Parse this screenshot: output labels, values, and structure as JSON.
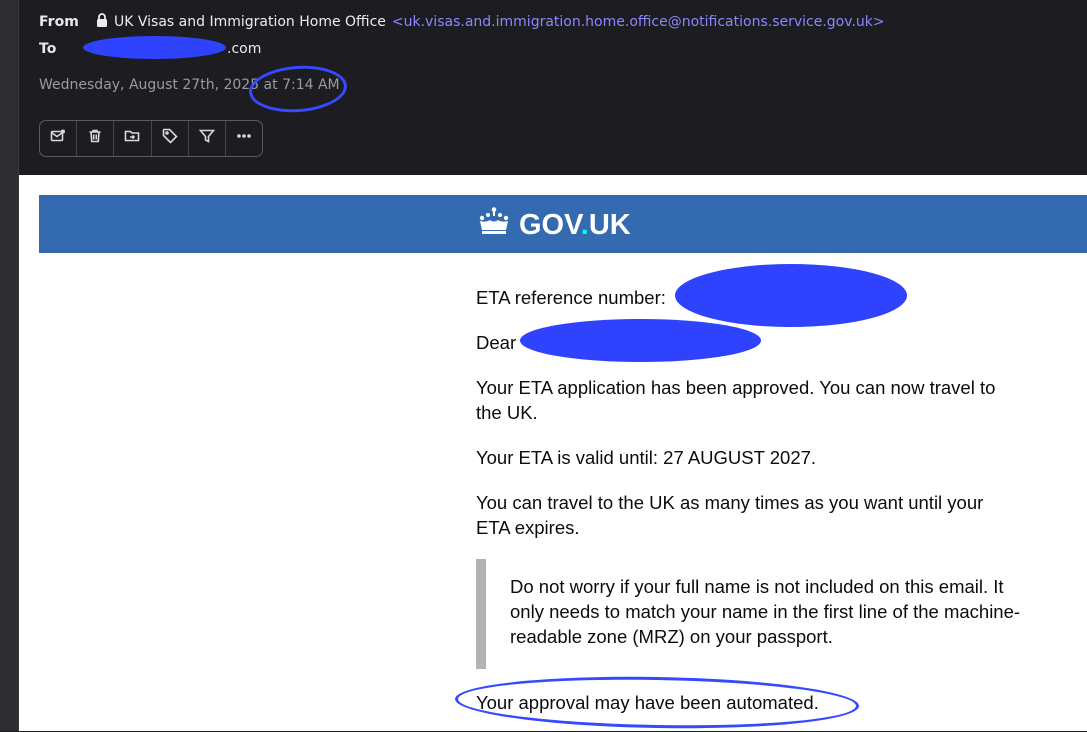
{
  "header": {
    "from_label": "From",
    "from_name": "UK Visas and Immigration Home Office",
    "from_email": "<uk.visas.and.immigration.home.office@notifications.service.gov.uk>",
    "to_label": "To",
    "to_value_suffix": ".com",
    "date": "Wednesday, August 27th, 2025 at 7:14 AM",
    "lock_icon": "lock-icon"
  },
  "toolbar": {
    "buttons": [
      {
        "name": "mark-unread",
        "icon": "mail-dot-icon"
      },
      {
        "name": "delete",
        "icon": "trash-icon"
      },
      {
        "name": "move",
        "icon": "folder-move-icon"
      },
      {
        "name": "label",
        "icon": "tag-icon"
      },
      {
        "name": "filter",
        "icon": "filter-icon"
      },
      {
        "name": "more",
        "icon": "ellipsis-icon"
      }
    ]
  },
  "email": {
    "gov_logo_text_a": "GOV",
    "gov_logo_dot": ".",
    "gov_logo_text_b": "UK",
    "ref_label": "ETA reference number:",
    "dear": "Dear",
    "approved_1": "Your ETA application has been approved. You can now travel to",
    "approved_2": "the UK.",
    "valid": "Your ETA is valid until: 27 AUGUST 2027.",
    "travel_1": "You can travel to the UK as many times as you want until your",
    "travel_2": "ETA expires.",
    "inset_1": "Do not worry if your full name is not included on this email. It",
    "inset_2": "only needs to match your name in the first line of the machine-",
    "inset_3": "readable zone (MRZ) on your passport.",
    "automated": "Your approval may have been automated."
  },
  "colors": {
    "gov_blue": "#346bb0",
    "annotation_blue": "#3549ff",
    "sender_email": "#8b86ff"
  }
}
